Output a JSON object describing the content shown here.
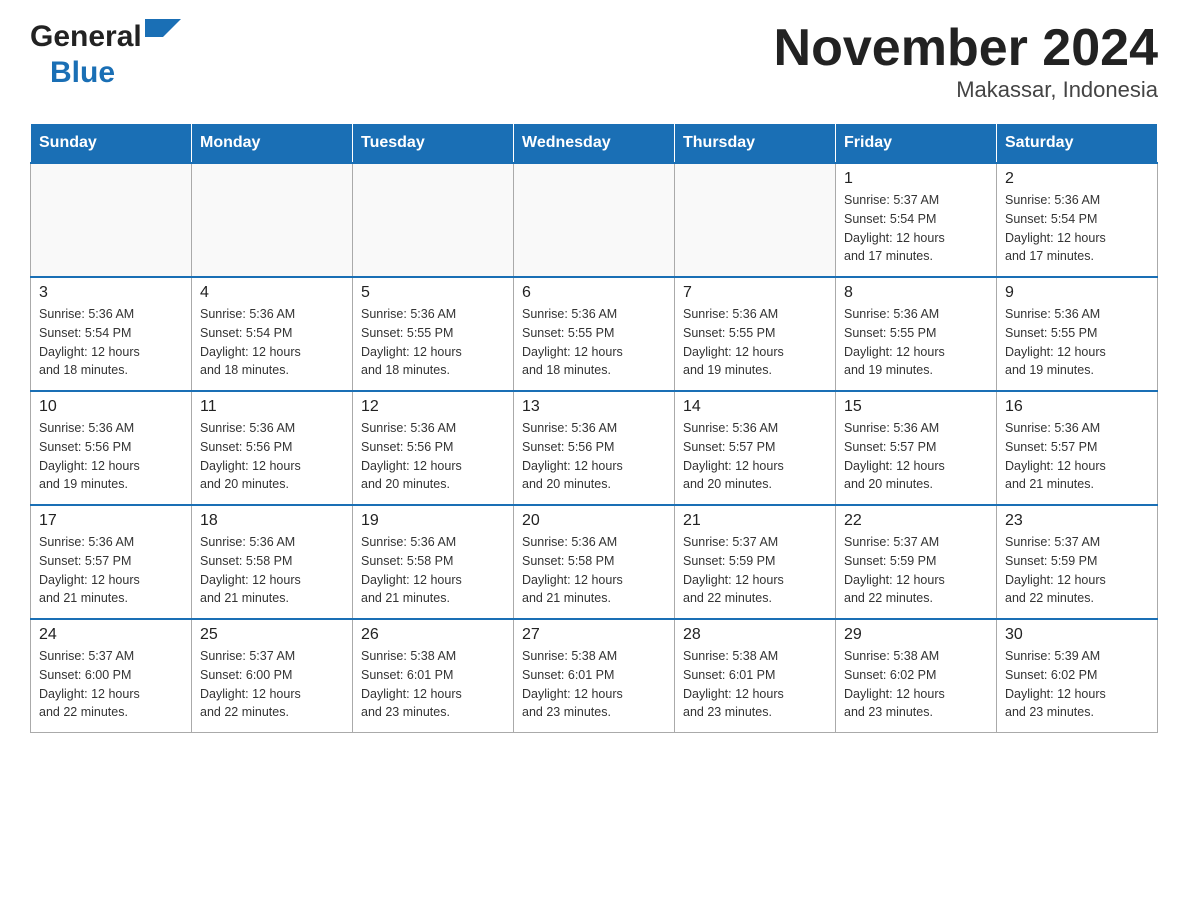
{
  "header": {
    "logo_general": "General",
    "logo_blue": "Blue",
    "title": "November 2024",
    "subtitle": "Makassar, Indonesia"
  },
  "days_of_week": [
    "Sunday",
    "Monday",
    "Tuesday",
    "Wednesday",
    "Thursday",
    "Friday",
    "Saturday"
  ],
  "weeks": [
    [
      {
        "day": "",
        "info": ""
      },
      {
        "day": "",
        "info": ""
      },
      {
        "day": "",
        "info": ""
      },
      {
        "day": "",
        "info": ""
      },
      {
        "day": "",
        "info": ""
      },
      {
        "day": "1",
        "info": "Sunrise: 5:37 AM\nSunset: 5:54 PM\nDaylight: 12 hours\nand 17 minutes."
      },
      {
        "day": "2",
        "info": "Sunrise: 5:36 AM\nSunset: 5:54 PM\nDaylight: 12 hours\nand 17 minutes."
      }
    ],
    [
      {
        "day": "3",
        "info": "Sunrise: 5:36 AM\nSunset: 5:54 PM\nDaylight: 12 hours\nand 18 minutes."
      },
      {
        "day": "4",
        "info": "Sunrise: 5:36 AM\nSunset: 5:54 PM\nDaylight: 12 hours\nand 18 minutes."
      },
      {
        "day": "5",
        "info": "Sunrise: 5:36 AM\nSunset: 5:55 PM\nDaylight: 12 hours\nand 18 minutes."
      },
      {
        "day": "6",
        "info": "Sunrise: 5:36 AM\nSunset: 5:55 PM\nDaylight: 12 hours\nand 18 minutes."
      },
      {
        "day": "7",
        "info": "Sunrise: 5:36 AM\nSunset: 5:55 PM\nDaylight: 12 hours\nand 19 minutes."
      },
      {
        "day": "8",
        "info": "Sunrise: 5:36 AM\nSunset: 5:55 PM\nDaylight: 12 hours\nand 19 minutes."
      },
      {
        "day": "9",
        "info": "Sunrise: 5:36 AM\nSunset: 5:55 PM\nDaylight: 12 hours\nand 19 minutes."
      }
    ],
    [
      {
        "day": "10",
        "info": "Sunrise: 5:36 AM\nSunset: 5:56 PM\nDaylight: 12 hours\nand 19 minutes."
      },
      {
        "day": "11",
        "info": "Sunrise: 5:36 AM\nSunset: 5:56 PM\nDaylight: 12 hours\nand 20 minutes."
      },
      {
        "day": "12",
        "info": "Sunrise: 5:36 AM\nSunset: 5:56 PM\nDaylight: 12 hours\nand 20 minutes."
      },
      {
        "day": "13",
        "info": "Sunrise: 5:36 AM\nSunset: 5:56 PM\nDaylight: 12 hours\nand 20 minutes."
      },
      {
        "day": "14",
        "info": "Sunrise: 5:36 AM\nSunset: 5:57 PM\nDaylight: 12 hours\nand 20 minutes."
      },
      {
        "day": "15",
        "info": "Sunrise: 5:36 AM\nSunset: 5:57 PM\nDaylight: 12 hours\nand 20 minutes."
      },
      {
        "day": "16",
        "info": "Sunrise: 5:36 AM\nSunset: 5:57 PM\nDaylight: 12 hours\nand 21 minutes."
      }
    ],
    [
      {
        "day": "17",
        "info": "Sunrise: 5:36 AM\nSunset: 5:57 PM\nDaylight: 12 hours\nand 21 minutes."
      },
      {
        "day": "18",
        "info": "Sunrise: 5:36 AM\nSunset: 5:58 PM\nDaylight: 12 hours\nand 21 minutes."
      },
      {
        "day": "19",
        "info": "Sunrise: 5:36 AM\nSunset: 5:58 PM\nDaylight: 12 hours\nand 21 minutes."
      },
      {
        "day": "20",
        "info": "Sunrise: 5:36 AM\nSunset: 5:58 PM\nDaylight: 12 hours\nand 21 minutes."
      },
      {
        "day": "21",
        "info": "Sunrise: 5:37 AM\nSunset: 5:59 PM\nDaylight: 12 hours\nand 22 minutes."
      },
      {
        "day": "22",
        "info": "Sunrise: 5:37 AM\nSunset: 5:59 PM\nDaylight: 12 hours\nand 22 minutes."
      },
      {
        "day": "23",
        "info": "Sunrise: 5:37 AM\nSunset: 5:59 PM\nDaylight: 12 hours\nand 22 minutes."
      }
    ],
    [
      {
        "day": "24",
        "info": "Sunrise: 5:37 AM\nSunset: 6:00 PM\nDaylight: 12 hours\nand 22 minutes."
      },
      {
        "day": "25",
        "info": "Sunrise: 5:37 AM\nSunset: 6:00 PM\nDaylight: 12 hours\nand 22 minutes."
      },
      {
        "day": "26",
        "info": "Sunrise: 5:38 AM\nSunset: 6:01 PM\nDaylight: 12 hours\nand 23 minutes."
      },
      {
        "day": "27",
        "info": "Sunrise: 5:38 AM\nSunset: 6:01 PM\nDaylight: 12 hours\nand 23 minutes."
      },
      {
        "day": "28",
        "info": "Sunrise: 5:38 AM\nSunset: 6:01 PM\nDaylight: 12 hours\nand 23 minutes."
      },
      {
        "day": "29",
        "info": "Sunrise: 5:38 AM\nSunset: 6:02 PM\nDaylight: 12 hours\nand 23 minutes."
      },
      {
        "day": "30",
        "info": "Sunrise: 5:39 AM\nSunset: 6:02 PM\nDaylight: 12 hours\nand 23 minutes."
      }
    ]
  ]
}
